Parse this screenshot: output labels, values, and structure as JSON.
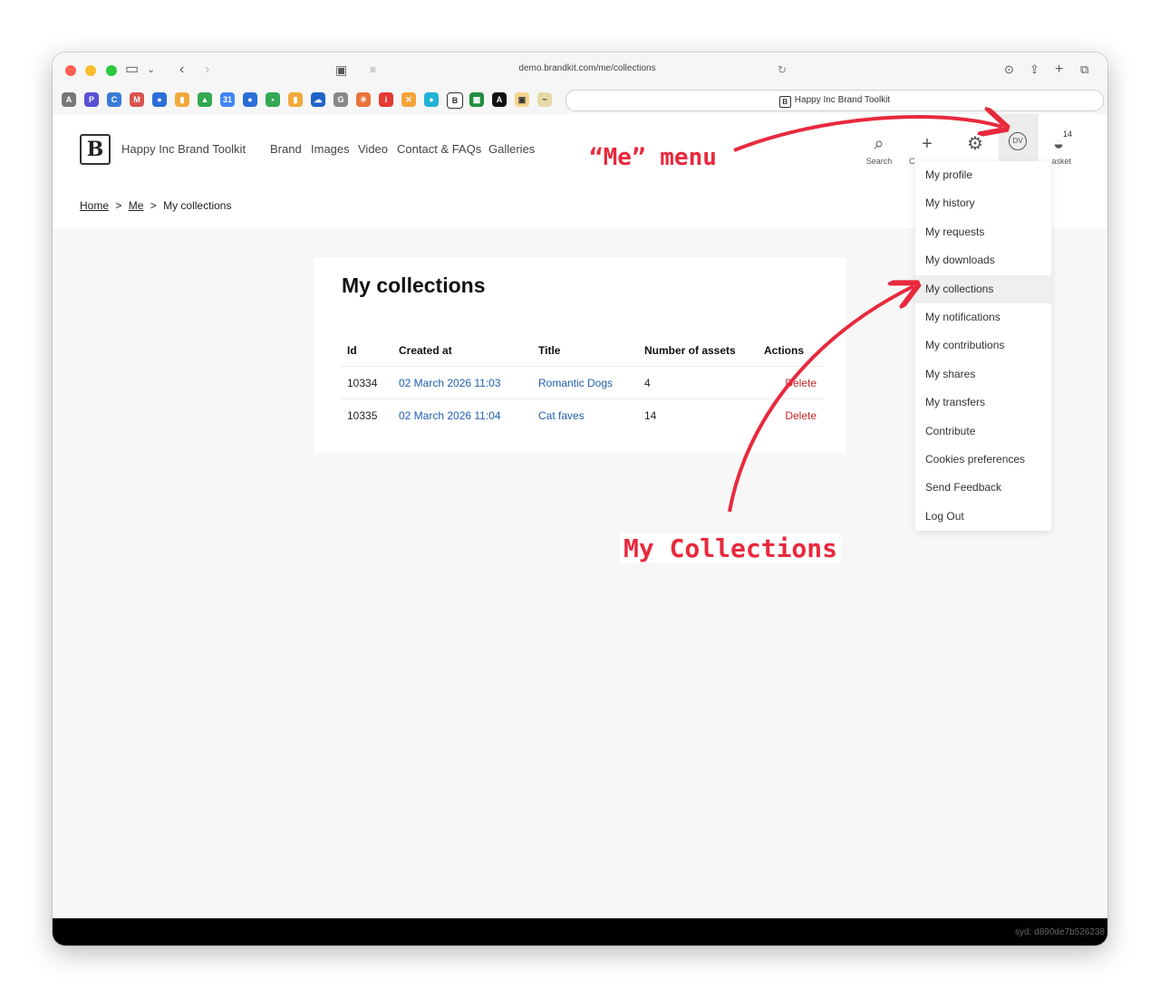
{
  "browser": {
    "url": "demo.brandkit.com/me/collections",
    "tab_title": "Happy Inc Brand Toolkit"
  },
  "site": {
    "brand_name": "Happy Inc Brand Toolkit",
    "nav": [
      "Brand",
      "Images",
      "Video",
      "Contact & FAQs",
      "Galleries"
    ],
    "header_icons": {
      "search": "Search",
      "create": "C",
      "avatar": "DV",
      "basket": "asket",
      "basket_count": "14"
    }
  },
  "breadcrumb": {
    "home": "Home",
    "me": "Me",
    "current": "My collections",
    "separator": ">"
  },
  "page": {
    "title": "My collections",
    "table": {
      "headers": [
        "Id",
        "Created at",
        "Title",
        "Number of assets",
        "Actions"
      ],
      "rows": [
        {
          "id": "10334",
          "created": "02 March 2026 11:03",
          "title": "Romantic Dogs",
          "assets": "4",
          "action": "Delete"
        },
        {
          "id": "10335",
          "created": "02 March 2026 11:04",
          "title": "Cat faves",
          "assets": "14",
          "action": "Delete"
        }
      ]
    }
  },
  "me_menu": {
    "items": [
      "My profile",
      "My history",
      "My requests",
      "My downloads",
      "My collections",
      "My notifications",
      "My contributions",
      "My shares",
      "My transfers",
      "Contribute",
      "Cookies preferences",
      "Send Feedback",
      "Log Out"
    ],
    "active_item": "My collections"
  },
  "annotations": {
    "me_menu": "“Me” menu",
    "my_collections": "My Collections"
  },
  "footer": {
    "build": "syd: d890de7b526238"
  },
  "colors": {
    "link": "#1f5fb0",
    "delete": "#c62828",
    "annotation": "#e8293d"
  }
}
